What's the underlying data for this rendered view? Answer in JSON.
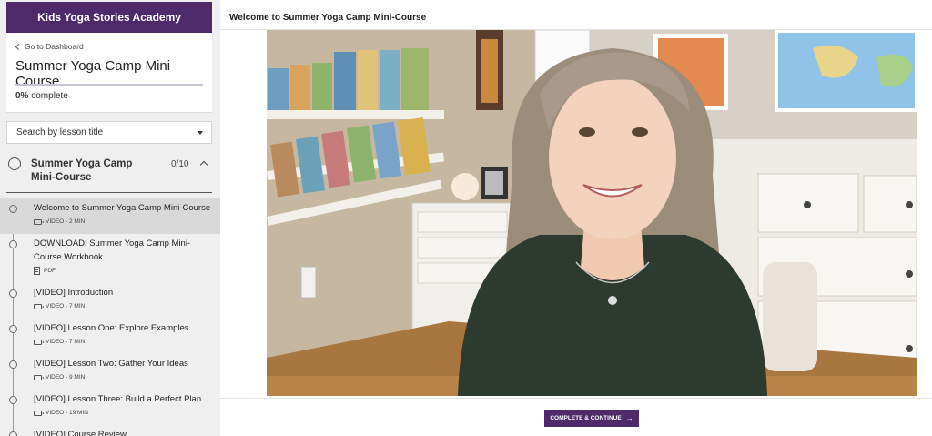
{
  "school": {
    "name": "Kids Yoga Stories Academy"
  },
  "course": {
    "back_label": "Go to Dashboard",
    "title": "Summer Yoga Camp Mini Course",
    "progress_percent": 0,
    "progress_value": "0%",
    "progress_label": "complete"
  },
  "search": {
    "label": "Search by lesson title"
  },
  "chapter": {
    "title": "Summer Yoga Camp Mini-Course",
    "count": "0/10"
  },
  "lessons": [
    {
      "title": "Welcome to Summer Yoga Camp Mini-Course",
      "icon": "video-icon",
      "meta": "VIDEO - 2 MIN",
      "active": true
    },
    {
      "title": "DOWNLOAD: Summer Yoga Camp Mini-Course Workbook",
      "icon": "pdf-icon",
      "meta": "PDF",
      "active": false
    },
    {
      "title": "[VIDEO] Introduction",
      "icon": "video-icon",
      "meta": "VIDEO - 7 MIN",
      "active": false
    },
    {
      "title": "[VIDEO] Lesson One: Explore Examples",
      "icon": "video-icon",
      "meta": "VIDEO - 7 MIN",
      "active": false
    },
    {
      "title": "[VIDEO] Lesson Two: Gather Your Ideas",
      "icon": "video-icon",
      "meta": "VIDEO - 9 MIN",
      "active": false
    },
    {
      "title": "[VIDEO] Lesson Three: Build a Perfect Plan",
      "icon": "video-icon",
      "meta": "VIDEO - 19 MIN",
      "active": false
    },
    {
      "title": "[VIDEO] Course Review",
      "icon": "video-icon",
      "meta": "",
      "active": false
    }
  ],
  "main": {
    "lesson_title": "Welcome to Summer Yoga Camp Mini-Course",
    "complete_button": "COMPLETE & CONTINUE",
    "complete_arrow": "→"
  },
  "colors": {
    "brand": "#4e2a6b",
    "sidebar_bg": "#efefef",
    "active_lesson_bg": "#d9d9d9"
  }
}
